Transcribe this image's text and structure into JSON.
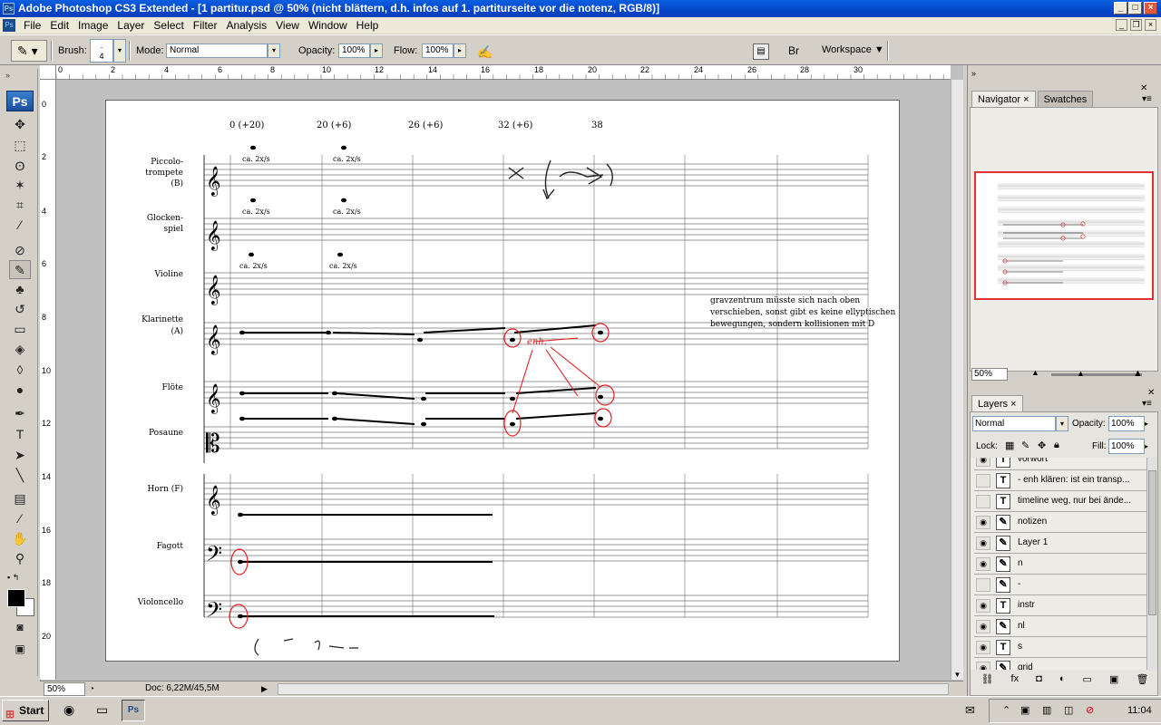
{
  "window": {
    "title": "Adobe Photoshop CS3 Extended - [1 partitur.psd @ 50% (nicht blättern, d.h. infos auf 1.  partiturseite vor die notenz, RGB/8)]",
    "app_icon": "Ps"
  },
  "menu": [
    "File",
    "Edit",
    "Image",
    "Layer",
    "Select",
    "Filter",
    "Analysis",
    "View",
    "Window",
    "Help"
  ],
  "options": {
    "brush_label": "Brush:",
    "brush_size": "4",
    "mode_label": "Mode:",
    "mode_value": "Normal",
    "opacity_label": "Opacity:",
    "opacity_value": "100%",
    "flow_label": "Flow:",
    "flow_value": "100%",
    "workspace_label": "Workspace ▼"
  },
  "toolbox": {
    "logo": "Ps",
    "tools": [
      "move-tool-icon",
      "marquee-tool-icon",
      "lasso-tool-icon",
      "magic-wand-icon",
      "crop-tool-icon",
      "eyedropper-icon",
      "healing-brush-icon",
      "brush-tool-icon",
      "clone-stamp-icon",
      "history-brush-icon",
      "eraser-icon",
      "paint-bucket-icon",
      "blur-tool-icon",
      "dodge-tool-icon",
      "pen-tool-icon",
      "type-tool-icon",
      "path-selection-icon",
      "line-tool-icon",
      "notes-tool-icon",
      "eyedropper-2-icon",
      "hand-tool-icon",
      "zoom-tool-icon"
    ]
  },
  "ruler": {
    "h": [
      "0",
      "2",
      "4",
      "6",
      "8",
      "10",
      "12",
      "14",
      "16",
      "18",
      "20",
      "22",
      "24",
      "26",
      "28",
      "30"
    ],
    "v": [
      "0",
      "2",
      "4",
      "6",
      "8",
      "10",
      "12",
      "14",
      "16",
      "18",
      "20"
    ]
  },
  "score": {
    "timings": [
      "0 (+20)",
      "20 (+6)",
      "26 (+6)",
      "32 (+6)",
      "38"
    ],
    "instruments": [
      "Piccolo-\ntrompete\n(B)",
      "Glocken-\nspiel",
      "Violine",
      "Klarinette\n(A)",
      "Flöte",
      "Posaune",
      "Horn (F)",
      "Fagott",
      "Violoncello"
    ],
    "rate_marking": "ca. 2x/s",
    "annotation_red": "enh.",
    "note": "gravzentrum müsste sich nach oben verschieben, sonst gibt es keine ellyptischen bewegungen, sondern kollisionen mit D"
  },
  "status": {
    "zoom": "50%",
    "doc": "Doc: 6,22M/45,5M"
  },
  "navigator": {
    "tabs": [
      "Navigator",
      "Swatches"
    ],
    "zoom": "50%"
  },
  "layers": {
    "tab": "Layers",
    "blend_mode": "Normal",
    "opacity_label": "Opacity:",
    "opacity_value": "100%",
    "lock_label": "Lock:",
    "fill_label": "Fill:",
    "fill_value": "100%",
    "items": [
      {
        "name": "vorwort",
        "type": "T",
        "visible": true
      },
      {
        "name": "- enh klären: ist ein transp...",
        "type": "T",
        "visible": false
      },
      {
        "name": "timeline weg, nur bei ände...",
        "type": "T",
        "visible": false
      },
      {
        "name": "notizen",
        "type": "brush",
        "visible": true
      },
      {
        "name": "Layer 1",
        "type": "brush",
        "visible": true
      },
      {
        "name": "n",
        "type": "brush",
        "visible": true
      },
      {
        "name": "-",
        "type": "brush",
        "visible": false
      },
      {
        "name": "instr",
        "type": "T",
        "visible": true
      },
      {
        "name": "nl",
        "type": "brush",
        "visible": true
      },
      {
        "name": "s",
        "type": "T",
        "visible": true
      },
      {
        "name": "grid",
        "type": "brush",
        "visible": true
      }
    ]
  },
  "taskbar": {
    "start": "Start",
    "clock": "11:04"
  },
  "colors": {
    "title_blue": "#0346c9",
    "annotation_red": "#e02020"
  }
}
